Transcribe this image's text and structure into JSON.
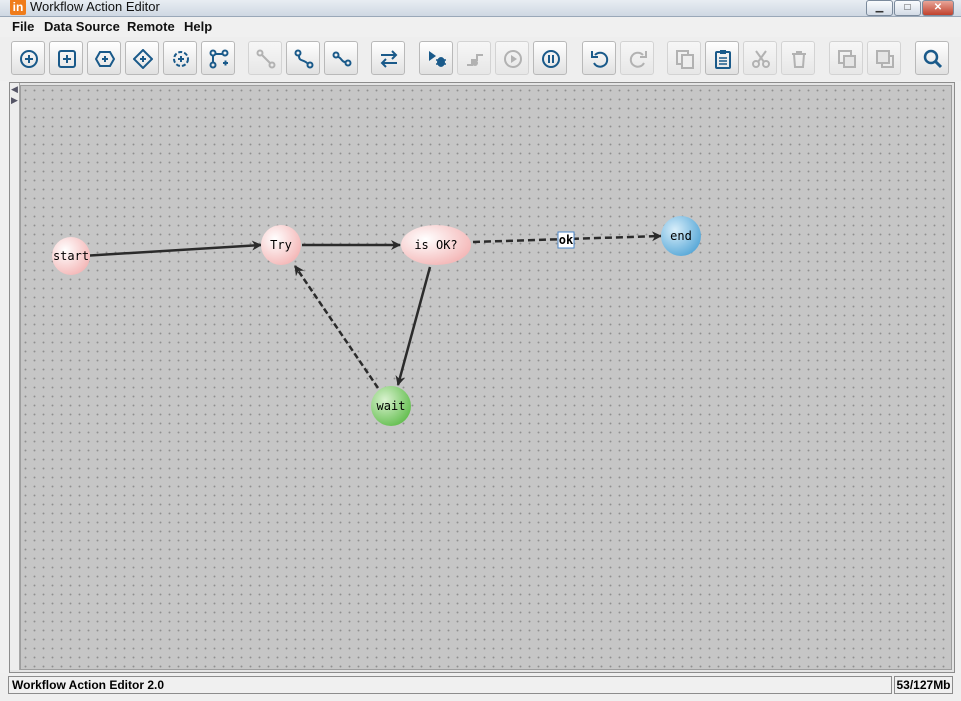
{
  "window": {
    "logo_text": "in",
    "title": "Workflow Action Editor",
    "minimize_glyph": "▁",
    "maximize_glyph": "□",
    "close_glyph": "✕"
  },
  "menu": {
    "items": [
      {
        "label": "File"
      },
      {
        "label": "Data Source"
      },
      {
        "label": "Remote"
      },
      {
        "label": "Help"
      }
    ]
  },
  "toolbar": {
    "buttons": [
      {
        "icon": "add-start-node-icon",
        "enabled": true
      },
      {
        "icon": "add-action-node-icon",
        "enabled": true
      },
      {
        "icon": "add-hexagon-node-icon",
        "enabled": true
      },
      {
        "icon": "add-decision-node-icon",
        "enabled": true
      },
      {
        "icon": "add-subflow-node-icon",
        "enabled": true
      },
      {
        "icon": "add-branch-icon",
        "enabled": true
      },
      {
        "icon": "connect-icon",
        "enabled": false
      },
      {
        "icon": "connect-success-icon",
        "enabled": true
      },
      {
        "icon": "connect-failure-icon",
        "enabled": true
      },
      {
        "icon": "swap-icon",
        "enabled": true
      },
      {
        "icon": "debug-run-icon",
        "enabled": true
      },
      {
        "icon": "step-icon",
        "enabled": false
      },
      {
        "icon": "play-icon",
        "enabled": false
      },
      {
        "icon": "pause-icon",
        "enabled": true
      },
      {
        "icon": "undo-icon",
        "enabled": true
      },
      {
        "icon": "redo-icon",
        "enabled": false
      },
      {
        "icon": "copy-icon",
        "enabled": false
      },
      {
        "icon": "paste-icon",
        "enabled": true
      },
      {
        "icon": "cut-icon",
        "enabled": false
      },
      {
        "icon": "delete-icon",
        "enabled": false
      },
      {
        "icon": "bring-front-icon",
        "enabled": false
      },
      {
        "icon": "send-back-icon",
        "enabled": false
      },
      {
        "icon": "search-icon",
        "enabled": true
      }
    ]
  },
  "graph": {
    "nodes": [
      {
        "id": "start",
        "label": "start",
        "color": "#f7c6c6"
      },
      {
        "id": "try",
        "label": "Try",
        "color": "#f7c6c6"
      },
      {
        "id": "isok",
        "label": "is OK?",
        "color": "#f7c6c6"
      },
      {
        "id": "end",
        "label": "end",
        "color": "#7fc0e6"
      },
      {
        "id": "wait",
        "label": "wait",
        "color": "#8fd47c"
      }
    ],
    "edges": [
      {
        "from": "start",
        "to": "try",
        "style": "solid",
        "label": ""
      },
      {
        "from": "try",
        "to": "isok",
        "style": "solid",
        "label": ""
      },
      {
        "from": "isok",
        "to": "end",
        "style": "dashed",
        "label": "ok"
      },
      {
        "from": "isok",
        "to": "wait",
        "style": "solid",
        "label": ""
      },
      {
        "from": "wait",
        "to": "try",
        "style": "dashed",
        "label": ""
      }
    ]
  },
  "status": {
    "left": "Workflow Action Editor 2.0",
    "right": "53/127Mb"
  }
}
